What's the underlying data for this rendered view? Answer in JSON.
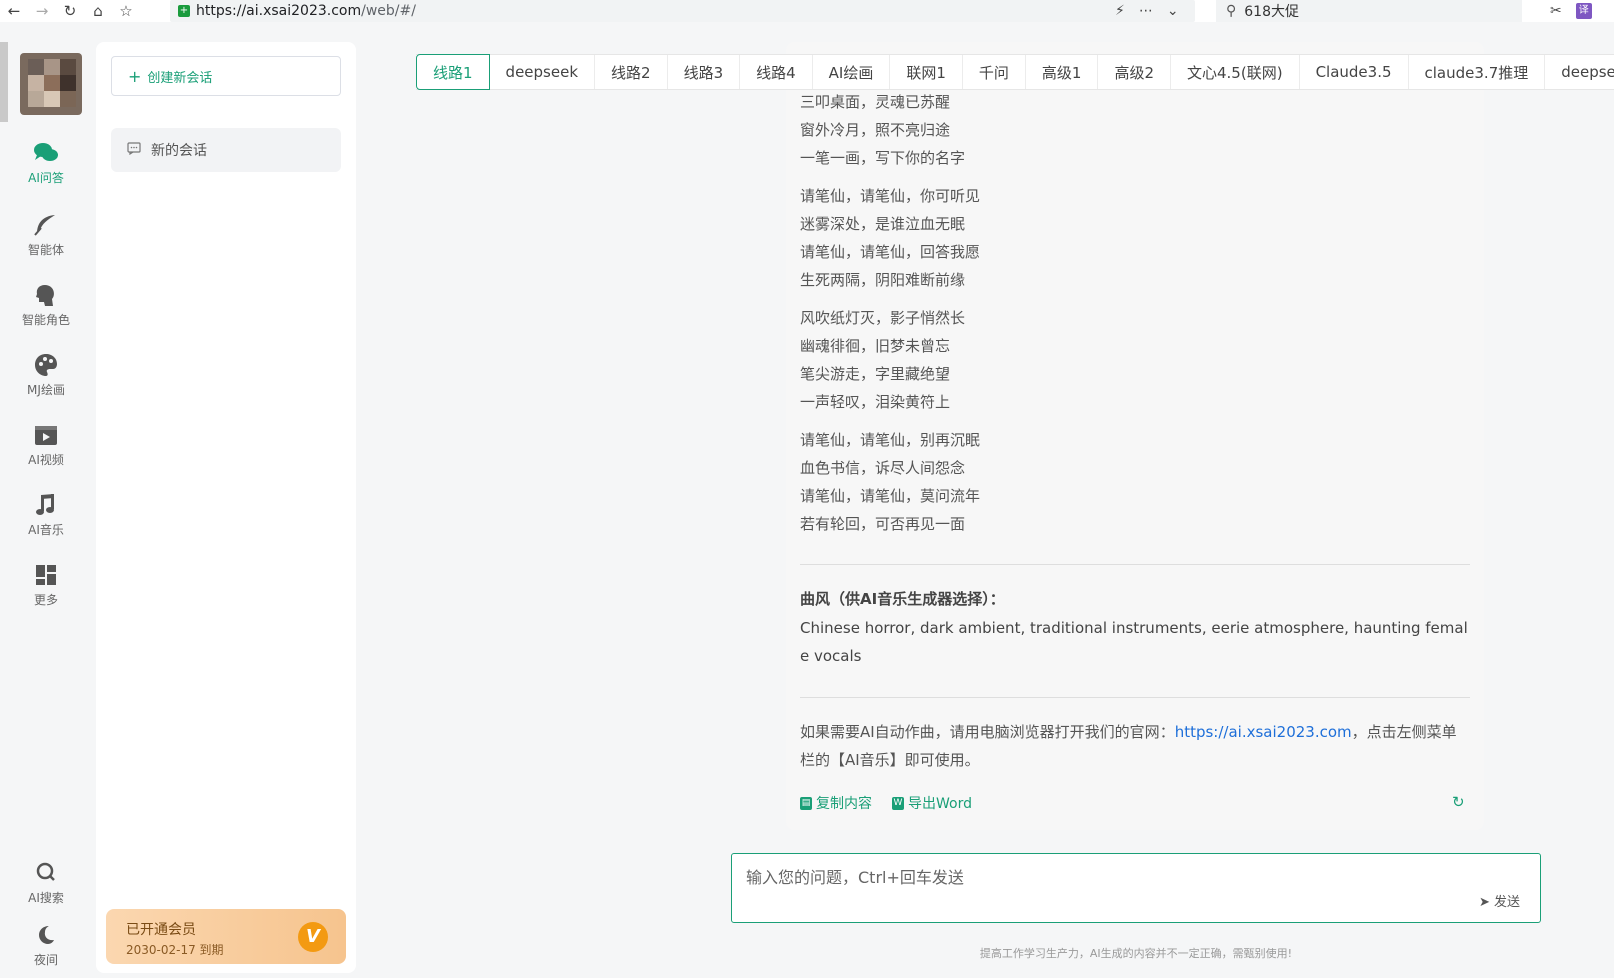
{
  "browser": {
    "url_host": "https://ai.xsai2023.com",
    "url_path": "/web/#/",
    "search_text": "618大促",
    "ext_label": "译"
  },
  "rail": {
    "items": [
      {
        "label": "AI问答",
        "icon": "chat-bubbles-icon",
        "active": true
      },
      {
        "label": "智能体",
        "icon": "feather-icon",
        "active": false
      },
      {
        "label": "智能角色",
        "icon": "head-profile-icon",
        "active": false
      },
      {
        "label": "MJ绘画",
        "icon": "palette-icon",
        "active": false
      },
      {
        "label": "AI视频",
        "icon": "video-icon",
        "active": false
      },
      {
        "label": "AI音乐",
        "icon": "music-note-icon",
        "active": false
      },
      {
        "label": "更多",
        "icon": "grid-icon",
        "active": false
      }
    ],
    "bottom": [
      {
        "label": "AI搜索",
        "icon": "search-icon"
      },
      {
        "label": "夜间",
        "icon": "moon-icon"
      }
    ]
  },
  "sidebar": {
    "new_chat_label": "创建新会话",
    "conversation": "新的会话",
    "member_title": "已开通会员",
    "member_expiry": "2030-02-17 到期",
    "member_badge": "V"
  },
  "tabs": [
    "线路1",
    "deepseek",
    "线路2",
    "线路3",
    "线路4",
    "AI绘画",
    "联网1",
    "千问",
    "高级1",
    "高级2",
    "文心4.5(联网)",
    "Claude3.5",
    "claude3.7推理",
    "deepsee"
  ],
  "message": {
    "stanzas": [
      [
        "三叩桌面，灵魂已苏醒",
        "窗外冷月，照不亮归途",
        "一笔一画，写下你的名字"
      ],
      [
        "请笔仙，请笔仙，你可听见",
        "迷雾深处，是谁泣血无眠",
        "请笔仙，请笔仙，回答我愿",
        "生死两隔，阴阳难断前缘"
      ],
      [
        "风吹纸灯灭，影子悄然长",
        "幽魂徘徊，旧梦未曾忘",
        "笔尖游走，字里藏绝望",
        "一声轻叹，泪染黄符上"
      ],
      [
        "请笔仙，请笔仙，别再沉眠",
        "血色书信，诉尽人间怨念",
        "请笔仙，请笔仙，莫问流年",
        "若有轮回，可否再见一面"
      ]
    ],
    "style_title": "曲风（供AI音乐生成器选择）：",
    "style_text": "Chinese horror, dark ambient, traditional instruments, eerie atmosphere, haunting female vocals",
    "note_prefix": "如果需要AI自动作曲，请用电脑浏览器打开我们的官网：",
    "note_link": "https://ai.xsai2023.com",
    "note_suffix": "，点击左侧菜单栏的【AI音乐】即可使用。",
    "copy_label": "复制内容",
    "export_label": "导出Word"
  },
  "input": {
    "placeholder": "输入您的问题，Ctrl+回车发送",
    "send_label": "发送"
  },
  "disclaimer": "提高工作学习生产力，AI生成的内容并不一定正确，需甄别使用!",
  "colors": {
    "accent": "#1a9f77",
    "link": "#1e6fd9",
    "member_bg": "#f6c48e"
  }
}
